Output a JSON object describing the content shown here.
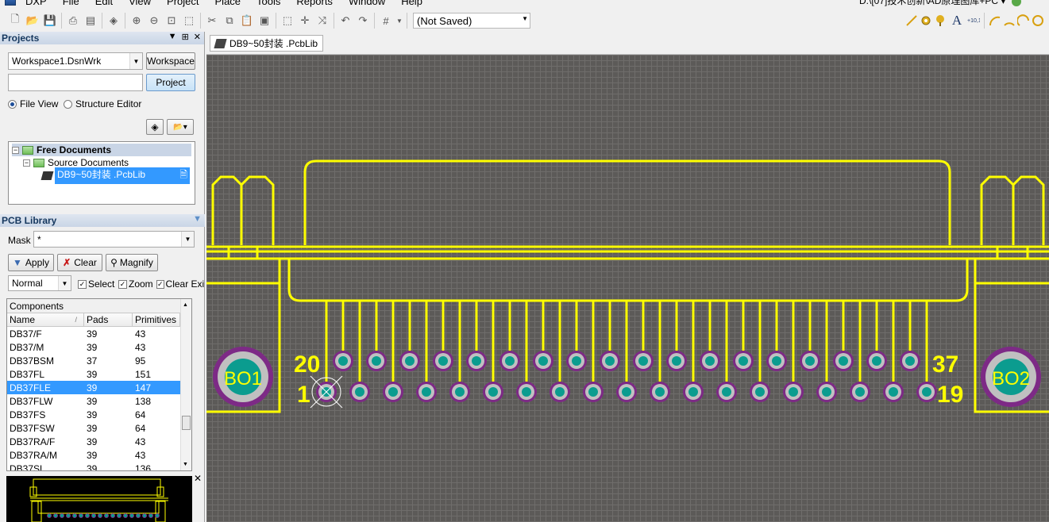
{
  "menu": {
    "items": [
      "DXP",
      "File",
      "Edit",
      "View",
      "Project",
      "Place",
      "Tools",
      "Reports",
      "Window",
      "Help"
    ],
    "title_path": "D:\\[07]技术创新\\AD原理图库+PC"
  },
  "toolbar": {
    "save_state": "(Not Saved)"
  },
  "projects_panel": {
    "title": "Projects",
    "workspace_value": "Workspace1.DsnWrk",
    "workspace_button": "Workspace",
    "project_input": "",
    "project_button": "Project",
    "view_options": [
      "File View",
      "Structure Editor"
    ],
    "selected_view": "File View",
    "tree": {
      "root": "Free Documents",
      "group": "Source Documents",
      "file": "DB9~50封装 .PcbLib"
    }
  },
  "pcb_library": {
    "title": "PCB Library",
    "mask_label": "Mask",
    "mask_value": "*",
    "apply": "Apply",
    "clear": "Clear",
    "magnify": "Magnify",
    "mode": "Normal",
    "checks": [
      "Select",
      "Zoom",
      "Clear Exi"
    ],
    "components_caption": "Components",
    "columns": [
      "Name",
      "Pads",
      "Primitives"
    ],
    "rows": [
      [
        "DB37/F",
        "39",
        "43"
      ],
      [
        "DB37/M",
        "39",
        "43"
      ],
      [
        "DB37BSM",
        "37",
        "95"
      ],
      [
        "DB37FL",
        "39",
        "151"
      ],
      [
        "DB37FLE",
        "39",
        "147"
      ],
      [
        "DB37FLW",
        "39",
        "138"
      ],
      [
        "DB37FS",
        "39",
        "64"
      ],
      [
        "DB37FSW",
        "39",
        "64"
      ],
      [
        "DB37RA/F",
        "39",
        "43"
      ],
      [
        "DB37RA/M",
        "39",
        "43"
      ],
      [
        "DB37SL",
        "39",
        "136"
      ]
    ],
    "selected_row": "DB37FLE"
  },
  "document": {
    "tab_label": "DB9~50封装 .PcbLib"
  },
  "footprint": {
    "pin_labels": {
      "top_left": "20",
      "bottom_left": "1",
      "top_right": "37",
      "bottom_right": "19"
    },
    "mount_holes": [
      "BO1",
      "BO2"
    ],
    "top_row_pins": 18,
    "bottom_row_pins": 19,
    "colors": {
      "silkscreen": "#ffff00",
      "pad_outer": "#7d2a86",
      "pad_ring": "#c0c0c0",
      "pad_hole": "#0b9c8f",
      "board": "#5c5a58"
    }
  }
}
